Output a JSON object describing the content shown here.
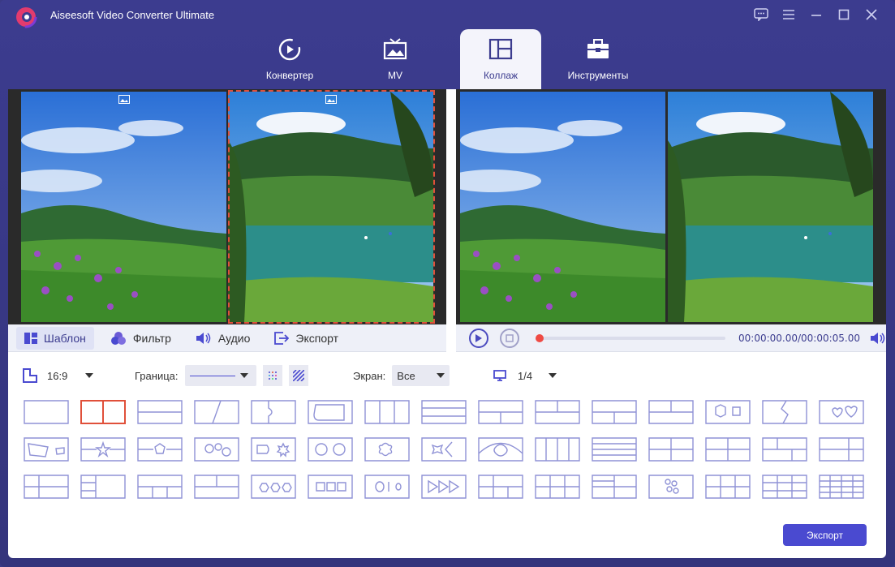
{
  "app": {
    "title": "Aiseesoft Video Converter Ultimate"
  },
  "tabs": [
    {
      "label": "Конвертер"
    },
    {
      "label": "MV"
    },
    {
      "label": "Коллаж"
    },
    {
      "label": "Инструменты"
    }
  ],
  "subtabs": [
    {
      "label": "Шаблон"
    },
    {
      "label": "Фильтр"
    },
    {
      "label": "Аудио"
    },
    {
      "label": "Экспорт"
    }
  ],
  "player": {
    "time": "00:00:00.00/00:00:05.00",
    "progress": 0
  },
  "options": {
    "ratio": "16:9",
    "border_label": "Граница:",
    "screen_label": "Экран:",
    "screen_value": "Все",
    "page_value": "1/4"
  },
  "colors": {
    "accent": "#4a4ad0",
    "header": "#3c3c8f",
    "selected": "#e0503a",
    "template_stroke": "#8f92d6"
  },
  "export_button": "Экспорт"
}
